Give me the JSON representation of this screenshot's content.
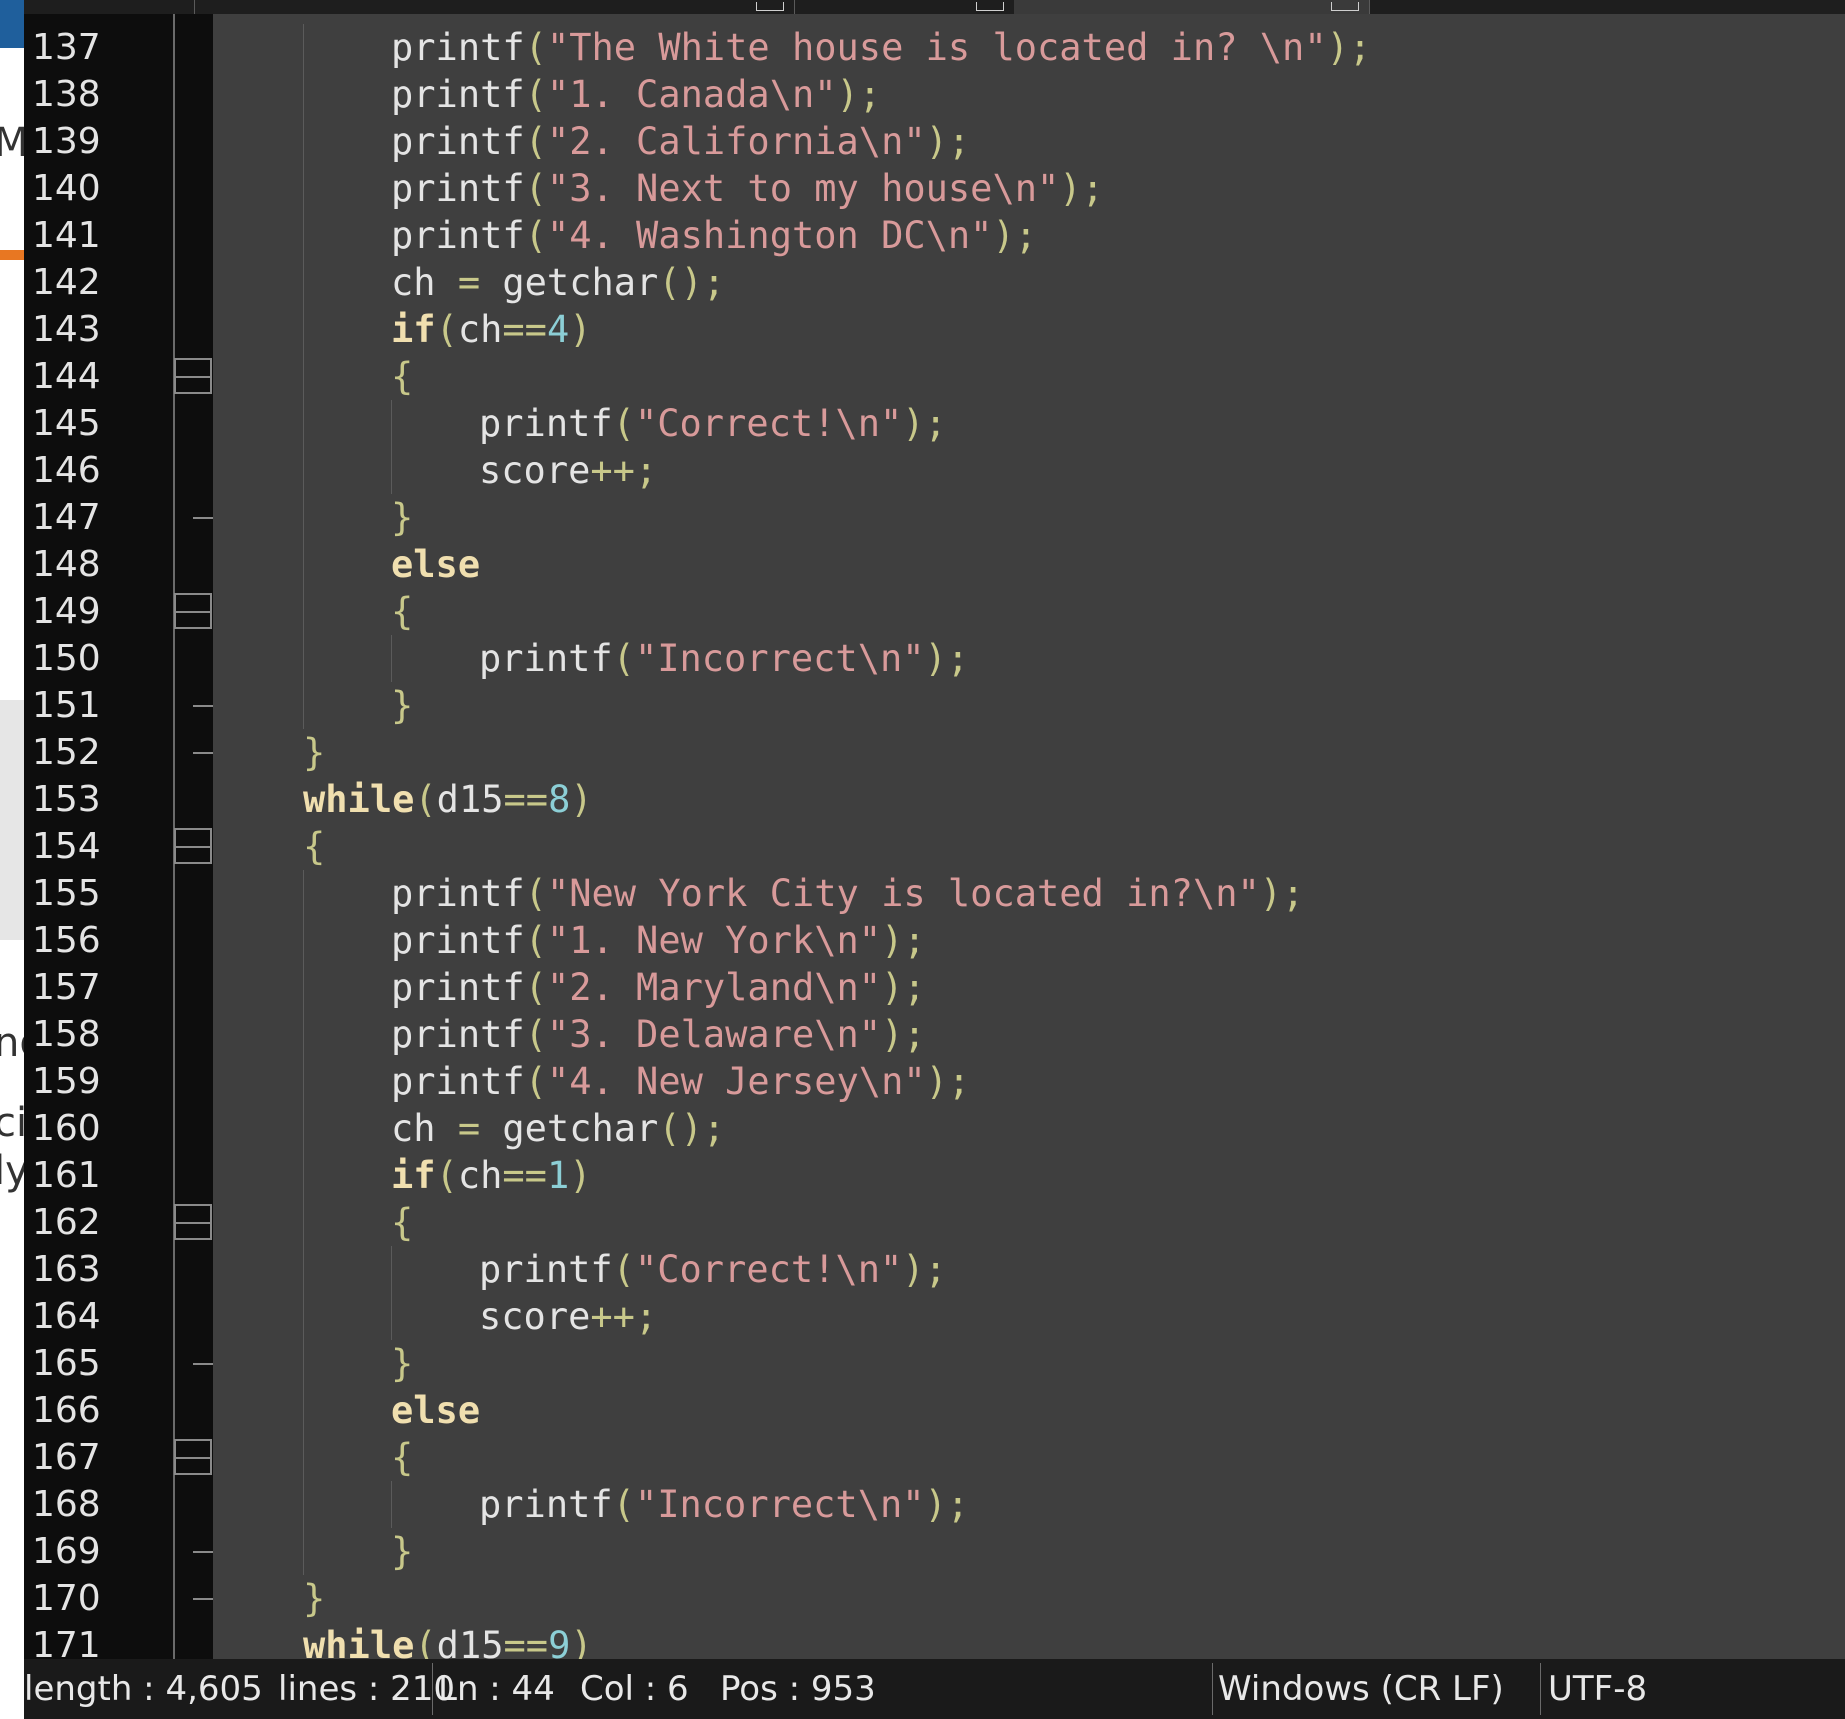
{
  "editor": {
    "lines": [
      {
        "num": "137",
        "indent": 2,
        "tokens": [
          {
            "t": "printf",
            "c": "id"
          },
          {
            "t": "(",
            "c": "op"
          },
          {
            "t": "\"The White house is located in? \\n\"",
            "c": "str"
          },
          {
            "t": ");",
            "c": "op"
          }
        ]
      },
      {
        "num": "138",
        "indent": 2,
        "tokens": [
          {
            "t": "printf",
            "c": "id"
          },
          {
            "t": "(",
            "c": "op"
          },
          {
            "t": "\"1. Canada\\n\"",
            "c": "str"
          },
          {
            "t": ");",
            "c": "op"
          }
        ]
      },
      {
        "num": "139",
        "indent": 2,
        "tokens": [
          {
            "t": "printf",
            "c": "id"
          },
          {
            "t": "(",
            "c": "op"
          },
          {
            "t": "\"2. California\\n\"",
            "c": "str"
          },
          {
            "t": ");",
            "c": "op"
          }
        ]
      },
      {
        "num": "140",
        "indent": 2,
        "tokens": [
          {
            "t": "printf",
            "c": "id"
          },
          {
            "t": "(",
            "c": "op"
          },
          {
            "t": "\"3. Next to my house\\n\"",
            "c": "str"
          },
          {
            "t": ");",
            "c": "op"
          }
        ]
      },
      {
        "num": "141",
        "indent": 2,
        "tokens": [
          {
            "t": "printf",
            "c": "id"
          },
          {
            "t": "(",
            "c": "op"
          },
          {
            "t": "\"4. Washington DC\\n\"",
            "c": "str"
          },
          {
            "t": ");",
            "c": "op"
          }
        ]
      },
      {
        "num": "142",
        "indent": 2,
        "tokens": [
          {
            "t": "ch ",
            "c": "id"
          },
          {
            "t": "=",
            "c": "op"
          },
          {
            "t": " getchar",
            "c": "id"
          },
          {
            "t": "();",
            "c": "op"
          }
        ]
      },
      {
        "num": "143",
        "indent": 2,
        "tokens": [
          {
            "t": "if",
            "c": "kw"
          },
          {
            "t": "(",
            "c": "op"
          },
          {
            "t": "ch",
            "c": "id"
          },
          {
            "t": "==",
            "c": "op"
          },
          {
            "t": "4",
            "c": "num"
          },
          {
            "t": ")",
            "c": "op"
          }
        ]
      },
      {
        "num": "144",
        "indent": 2,
        "tokens": [
          {
            "t": "{",
            "c": "op"
          }
        ]
      },
      {
        "num": "145",
        "indent": 3,
        "tokens": [
          {
            "t": "printf",
            "c": "id"
          },
          {
            "t": "(",
            "c": "op"
          },
          {
            "t": "\"Correct!\\n\"",
            "c": "str"
          },
          {
            "t": ");",
            "c": "op"
          }
        ]
      },
      {
        "num": "146",
        "indent": 3,
        "tokens": [
          {
            "t": "score",
            "c": "id"
          },
          {
            "t": "++;",
            "c": "op"
          }
        ]
      },
      {
        "num": "147",
        "indent": 2,
        "tokens": [
          {
            "t": "}",
            "c": "op"
          }
        ]
      },
      {
        "num": "148",
        "indent": 2,
        "tokens": [
          {
            "t": "else",
            "c": "kw"
          }
        ]
      },
      {
        "num": "149",
        "indent": 2,
        "tokens": [
          {
            "t": "{",
            "c": "op"
          }
        ]
      },
      {
        "num": "150",
        "indent": 3,
        "tokens": [
          {
            "t": "printf",
            "c": "id"
          },
          {
            "t": "(",
            "c": "op"
          },
          {
            "t": "\"Incorrect\\n\"",
            "c": "str"
          },
          {
            "t": ");",
            "c": "op"
          }
        ]
      },
      {
        "num": "151",
        "indent": 2,
        "tokens": [
          {
            "t": "}",
            "c": "op"
          }
        ]
      },
      {
        "num": "152",
        "indent": 1,
        "tokens": [
          {
            "t": "}",
            "c": "op"
          }
        ]
      },
      {
        "num": "153",
        "indent": 1,
        "tokens": [
          {
            "t": "while",
            "c": "kw"
          },
          {
            "t": "(",
            "c": "op"
          },
          {
            "t": "d15",
            "c": "id"
          },
          {
            "t": "==",
            "c": "op"
          },
          {
            "t": "8",
            "c": "num"
          },
          {
            "t": ")",
            "c": "op"
          }
        ]
      },
      {
        "num": "154",
        "indent": 1,
        "tokens": [
          {
            "t": "{",
            "c": "op"
          }
        ]
      },
      {
        "num": "155",
        "indent": 2,
        "tokens": [
          {
            "t": "printf",
            "c": "id"
          },
          {
            "t": "(",
            "c": "op"
          },
          {
            "t": "\"New York City is located in?\\n\"",
            "c": "str"
          },
          {
            "t": ");",
            "c": "op"
          }
        ]
      },
      {
        "num": "156",
        "indent": 2,
        "tokens": [
          {
            "t": "printf",
            "c": "id"
          },
          {
            "t": "(",
            "c": "op"
          },
          {
            "t": "\"1. New York\\n\"",
            "c": "str"
          },
          {
            "t": ");",
            "c": "op"
          }
        ]
      },
      {
        "num": "157",
        "indent": 2,
        "tokens": [
          {
            "t": "printf",
            "c": "id"
          },
          {
            "t": "(",
            "c": "op"
          },
          {
            "t": "\"2. Maryland\\n\"",
            "c": "str"
          },
          {
            "t": ");",
            "c": "op"
          }
        ]
      },
      {
        "num": "158",
        "indent": 2,
        "tokens": [
          {
            "t": "printf",
            "c": "id"
          },
          {
            "t": "(",
            "c": "op"
          },
          {
            "t": "\"3. Delaware\\n\"",
            "c": "str"
          },
          {
            "t": ");",
            "c": "op"
          }
        ]
      },
      {
        "num": "159",
        "indent": 2,
        "tokens": [
          {
            "t": "printf",
            "c": "id"
          },
          {
            "t": "(",
            "c": "op"
          },
          {
            "t": "\"4. New Jersey\\n\"",
            "c": "str"
          },
          {
            "t": ");",
            "c": "op"
          }
        ]
      },
      {
        "num": "160",
        "indent": 2,
        "tokens": [
          {
            "t": "ch ",
            "c": "id"
          },
          {
            "t": "=",
            "c": "op"
          },
          {
            "t": " getchar",
            "c": "id"
          },
          {
            "t": "();",
            "c": "op"
          }
        ]
      },
      {
        "num": "161",
        "indent": 2,
        "tokens": [
          {
            "t": "if",
            "c": "kw"
          },
          {
            "t": "(",
            "c": "op"
          },
          {
            "t": "ch",
            "c": "id"
          },
          {
            "t": "==",
            "c": "op"
          },
          {
            "t": "1",
            "c": "num"
          },
          {
            "t": ")",
            "c": "op"
          }
        ]
      },
      {
        "num": "162",
        "indent": 2,
        "tokens": [
          {
            "t": "{",
            "c": "op"
          }
        ]
      },
      {
        "num": "163",
        "indent": 3,
        "tokens": [
          {
            "t": "printf",
            "c": "id"
          },
          {
            "t": "(",
            "c": "op"
          },
          {
            "t": "\"Correct!\\n\"",
            "c": "str"
          },
          {
            "t": ");",
            "c": "op"
          }
        ]
      },
      {
        "num": "164",
        "indent": 3,
        "tokens": [
          {
            "t": "score",
            "c": "id"
          },
          {
            "t": "++;",
            "c": "op"
          }
        ]
      },
      {
        "num": "165",
        "indent": 2,
        "tokens": [
          {
            "t": "}",
            "c": "op"
          }
        ]
      },
      {
        "num": "166",
        "indent": 2,
        "tokens": [
          {
            "t": "else",
            "c": "kw"
          }
        ]
      },
      {
        "num": "167",
        "indent": 2,
        "tokens": [
          {
            "t": "{",
            "c": "op"
          }
        ]
      },
      {
        "num": "168",
        "indent": 3,
        "tokens": [
          {
            "t": "printf",
            "c": "id"
          },
          {
            "t": "(",
            "c": "op"
          },
          {
            "t": "\"Incorrect\\n\"",
            "c": "str"
          },
          {
            "t": ");",
            "c": "op"
          }
        ]
      },
      {
        "num": "169",
        "indent": 2,
        "tokens": [
          {
            "t": "}",
            "c": "op"
          }
        ]
      },
      {
        "num": "170",
        "indent": 1,
        "tokens": [
          {
            "t": "}",
            "c": "op"
          }
        ]
      },
      {
        "num": "171",
        "indent": 1,
        "tokens": [
          {
            "t": "while",
            "c": "kw"
          },
          {
            "t": "(",
            "c": "op"
          },
          {
            "t": "d15",
            "c": "id"
          },
          {
            "t": "==",
            "c": "op"
          },
          {
            "t": "9",
            "c": "num"
          },
          {
            "t": ")",
            "c": "op"
          }
        ]
      }
    ],
    "fold_open_lines": [
      "144",
      "149",
      "154",
      "162",
      "167"
    ],
    "fold_close_lines": [
      "147",
      "151",
      "152",
      "165",
      "169",
      "170"
    ]
  },
  "statusbar": {
    "length": "length : 4,605",
    "lines": "lines : 210",
    "ln": "Ln : 44",
    "col": "Col : 6",
    "pos": "Pos : 953",
    "eol": "Windows (CR LF)",
    "encoding": "UTF-8"
  },
  "background_fragments": {
    "f1": "M",
    "f2": "ng",
    "f3": "ci",
    "f4": "ly"
  },
  "colors": {
    "editor_bg": "#3f3f3f",
    "keyword": "#f0dfaf",
    "string": "#d89a9a",
    "number": "#8ccfd6",
    "operator": "#c8c88a"
  }
}
